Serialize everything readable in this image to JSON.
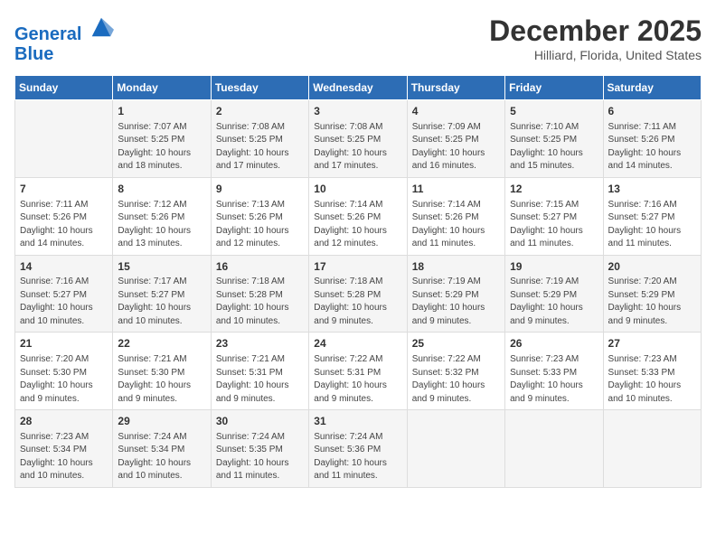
{
  "logo": {
    "line1": "General",
    "line2": "Blue"
  },
  "title": "December 2025",
  "location": "Hilliard, Florida, United States",
  "days_header": [
    "Sunday",
    "Monday",
    "Tuesday",
    "Wednesday",
    "Thursday",
    "Friday",
    "Saturday"
  ],
  "weeks": [
    [
      {
        "day": "",
        "info": ""
      },
      {
        "day": "1",
        "info": "Sunrise: 7:07 AM\nSunset: 5:25 PM\nDaylight: 10 hours\nand 18 minutes."
      },
      {
        "day": "2",
        "info": "Sunrise: 7:08 AM\nSunset: 5:25 PM\nDaylight: 10 hours\nand 17 minutes."
      },
      {
        "day": "3",
        "info": "Sunrise: 7:08 AM\nSunset: 5:25 PM\nDaylight: 10 hours\nand 17 minutes."
      },
      {
        "day": "4",
        "info": "Sunrise: 7:09 AM\nSunset: 5:25 PM\nDaylight: 10 hours\nand 16 minutes."
      },
      {
        "day": "5",
        "info": "Sunrise: 7:10 AM\nSunset: 5:25 PM\nDaylight: 10 hours\nand 15 minutes."
      },
      {
        "day": "6",
        "info": "Sunrise: 7:11 AM\nSunset: 5:26 PM\nDaylight: 10 hours\nand 14 minutes."
      }
    ],
    [
      {
        "day": "7",
        "info": "Sunrise: 7:11 AM\nSunset: 5:26 PM\nDaylight: 10 hours\nand 14 minutes."
      },
      {
        "day": "8",
        "info": "Sunrise: 7:12 AM\nSunset: 5:26 PM\nDaylight: 10 hours\nand 13 minutes."
      },
      {
        "day": "9",
        "info": "Sunrise: 7:13 AM\nSunset: 5:26 PM\nDaylight: 10 hours\nand 12 minutes."
      },
      {
        "day": "10",
        "info": "Sunrise: 7:14 AM\nSunset: 5:26 PM\nDaylight: 10 hours\nand 12 minutes."
      },
      {
        "day": "11",
        "info": "Sunrise: 7:14 AM\nSunset: 5:26 PM\nDaylight: 10 hours\nand 11 minutes."
      },
      {
        "day": "12",
        "info": "Sunrise: 7:15 AM\nSunset: 5:27 PM\nDaylight: 10 hours\nand 11 minutes."
      },
      {
        "day": "13",
        "info": "Sunrise: 7:16 AM\nSunset: 5:27 PM\nDaylight: 10 hours\nand 11 minutes."
      }
    ],
    [
      {
        "day": "14",
        "info": "Sunrise: 7:16 AM\nSunset: 5:27 PM\nDaylight: 10 hours\nand 10 minutes."
      },
      {
        "day": "15",
        "info": "Sunrise: 7:17 AM\nSunset: 5:27 PM\nDaylight: 10 hours\nand 10 minutes."
      },
      {
        "day": "16",
        "info": "Sunrise: 7:18 AM\nSunset: 5:28 PM\nDaylight: 10 hours\nand 10 minutes."
      },
      {
        "day": "17",
        "info": "Sunrise: 7:18 AM\nSunset: 5:28 PM\nDaylight: 10 hours\nand 9 minutes."
      },
      {
        "day": "18",
        "info": "Sunrise: 7:19 AM\nSunset: 5:29 PM\nDaylight: 10 hours\nand 9 minutes."
      },
      {
        "day": "19",
        "info": "Sunrise: 7:19 AM\nSunset: 5:29 PM\nDaylight: 10 hours\nand 9 minutes."
      },
      {
        "day": "20",
        "info": "Sunrise: 7:20 AM\nSunset: 5:29 PM\nDaylight: 10 hours\nand 9 minutes."
      }
    ],
    [
      {
        "day": "21",
        "info": "Sunrise: 7:20 AM\nSunset: 5:30 PM\nDaylight: 10 hours\nand 9 minutes."
      },
      {
        "day": "22",
        "info": "Sunrise: 7:21 AM\nSunset: 5:30 PM\nDaylight: 10 hours\nand 9 minutes."
      },
      {
        "day": "23",
        "info": "Sunrise: 7:21 AM\nSunset: 5:31 PM\nDaylight: 10 hours\nand 9 minutes."
      },
      {
        "day": "24",
        "info": "Sunrise: 7:22 AM\nSunset: 5:31 PM\nDaylight: 10 hours\nand 9 minutes."
      },
      {
        "day": "25",
        "info": "Sunrise: 7:22 AM\nSunset: 5:32 PM\nDaylight: 10 hours\nand 9 minutes."
      },
      {
        "day": "26",
        "info": "Sunrise: 7:23 AM\nSunset: 5:33 PM\nDaylight: 10 hours\nand 9 minutes."
      },
      {
        "day": "27",
        "info": "Sunrise: 7:23 AM\nSunset: 5:33 PM\nDaylight: 10 hours\nand 10 minutes."
      }
    ],
    [
      {
        "day": "28",
        "info": "Sunrise: 7:23 AM\nSunset: 5:34 PM\nDaylight: 10 hours\nand 10 minutes."
      },
      {
        "day": "29",
        "info": "Sunrise: 7:24 AM\nSunset: 5:34 PM\nDaylight: 10 hours\nand 10 minutes."
      },
      {
        "day": "30",
        "info": "Sunrise: 7:24 AM\nSunset: 5:35 PM\nDaylight: 10 hours\nand 11 minutes."
      },
      {
        "day": "31",
        "info": "Sunrise: 7:24 AM\nSunset: 5:36 PM\nDaylight: 10 hours\nand 11 minutes."
      },
      {
        "day": "",
        "info": ""
      },
      {
        "day": "",
        "info": ""
      },
      {
        "day": "",
        "info": ""
      }
    ]
  ]
}
